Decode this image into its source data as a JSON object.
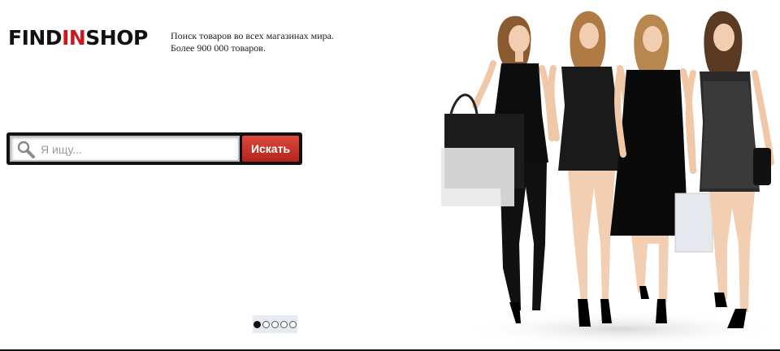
{
  "brand": {
    "logo_part1": "FIND",
    "logo_part2": "IN",
    "logo_part3": "SHOP"
  },
  "tagline": {
    "line1": "Поиск товаров во всех магазинах мира.",
    "line2": "Более 900 000 товаров."
  },
  "search": {
    "placeholder": "Я ищу...",
    "value": "",
    "button_label": "Искать"
  },
  "slider": {
    "total_slides": 5,
    "active_index": 0
  },
  "colors": {
    "accent": "#d0161d",
    "button": "#c1372c",
    "frame": "#111111"
  }
}
